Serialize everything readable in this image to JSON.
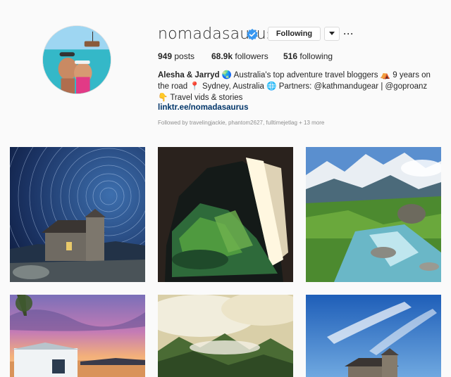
{
  "profile": {
    "username": "nomadasaurus",
    "follow_button_label": "Following",
    "more_label": "···",
    "stats": {
      "posts_count": "949",
      "posts_label": "posts",
      "followers_count": "68.9k",
      "followers_label": "followers",
      "following_count": "516",
      "following_label": "following"
    },
    "bio": {
      "name": "Alesha & Jarryd",
      "text_1": "Australia's top adventure travel bloggers",
      "text_2": "9 years on the road",
      "text_3": "Sydney, Australia",
      "text_4": "Partners: @kathmandugear | @goproanz",
      "text_5": "Travel vids & stories"
    },
    "link": "linktr.ee/nomadasaurus",
    "followed_by": "Followed by travelingjackie, phantom2627, fulltimejetlag",
    "followed_more": "+ 13 more"
  },
  "icons": {
    "globe": "globe-emoji",
    "tent": "tent-emoji",
    "pin": "round-pushpin-emoji",
    "globe_net": "globe-with-meridians-emoji",
    "hand": "hand-pointing-down-emoji",
    "verified": "verified-badge-icon",
    "chevron": "chevron-down-icon"
  },
  "colors": {
    "verified_blue": "#3897f0",
    "link_blue": "#003569",
    "text": "#262626",
    "muted": "#8e8e8e",
    "background": "#fafafa"
  },
  "posts": [
    {
      "id": "post-1",
      "subject": "star trails over stone church"
    },
    {
      "id": "post-2",
      "subject": "cave with light beam"
    },
    {
      "id": "post-3",
      "subject": "mountain river"
    },
    {
      "id": "post-4",
      "subject": "lake boathouse at sunset"
    },
    {
      "id": "post-5",
      "subject": "misty mountains"
    },
    {
      "id": "post-6",
      "subject": "stone church under blue sky"
    }
  ]
}
